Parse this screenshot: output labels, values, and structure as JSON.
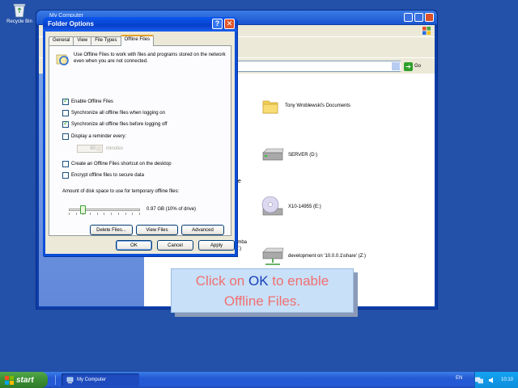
{
  "desktop": {
    "recycle_bin_label": "Recycle Bin"
  },
  "my_computer": {
    "title": "My Computer",
    "items": [
      {
        "label": "Tony Wroblewski's Documents",
        "icon": "folder-icon"
      },
      {
        "label": "SERVER (D:)",
        "icon": "hard-drive-icon"
      },
      {
        "label": "X10-14955 (E:)",
        "icon": "cd-drive-icon"
      },
      {
        "label": "development on '10.0.0.1\\share' (Z:)",
        "icon": "network-drive-icon"
      }
    ],
    "group_fragments": {
      "storage": "ge",
      "samba_line1": "amba",
      "samba_line2": "' (Y:)"
    },
    "go_label": "Go"
  },
  "dialog": {
    "title": "Folder Options",
    "help_glyph": "?",
    "close_glyph": "✕",
    "tabs": [
      "General",
      "View",
      "File Types",
      "Offline Files"
    ],
    "active_tab": 3,
    "info_text": "Use Offline Files to work with files and programs stored on the network even when you are not connected.",
    "checkboxes": {
      "enable": {
        "label": "Enable Offline Files",
        "checked": true
      },
      "sync_logon": {
        "label": "Synchronize all offline files when logging on",
        "checked": false
      },
      "sync_logoff": {
        "label": "Synchronize all offline files before logging off",
        "checked": true
      },
      "reminder": {
        "label": "Display a reminder every:",
        "checked": false
      },
      "shortcut": {
        "label": "Create an Offline Files shortcut on the desktop",
        "checked": false
      },
      "encrypt": {
        "label": "Encrypt offline files to secure data",
        "checked": false
      }
    },
    "reminder_value": "60",
    "reminder_unit": "minutes",
    "disk_space_label": "Amount of disk space to use for temporary offline files:",
    "disk_space_value": "0.97 GB (10% of drive)",
    "disk_space_fraction": 0.1,
    "buttons": {
      "delete_files": "Delete Files...",
      "view_files": "View Files",
      "advanced": "Advanced",
      "ok": "OK",
      "cancel": "Cancel",
      "apply": "Apply"
    }
  },
  "balloon": {
    "part1": "Click on ",
    "keyword": "OK",
    "part2": " to enable",
    "line2": "Offline Files."
  },
  "taskbar": {
    "start_label": "start",
    "task_label": "My Computer",
    "language": "EN",
    "clock": "10:10"
  },
  "colors": {
    "desktop": "#2350a8",
    "title_bar": "#0a58f0",
    "balloon_text": "#f07070",
    "balloon_keyword": "#1840b8"
  }
}
